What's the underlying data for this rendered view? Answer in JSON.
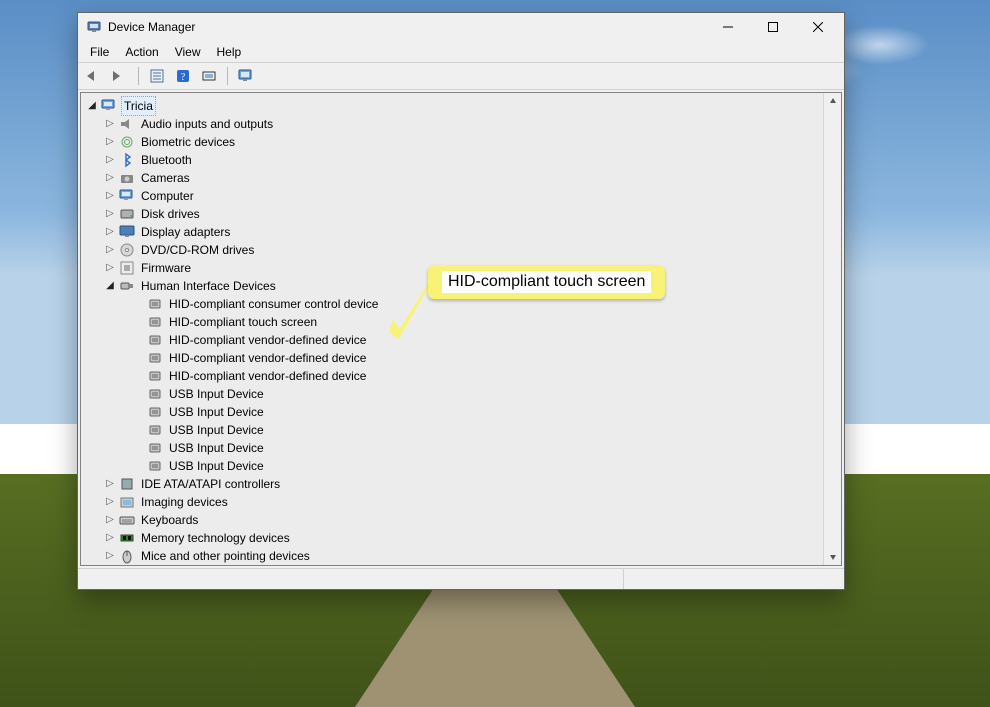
{
  "window": {
    "title": "Device Manager"
  },
  "menu": {
    "file": "File",
    "action": "Action",
    "view": "View",
    "help": "Help"
  },
  "tree": {
    "root": "Tricia",
    "categories": [
      {
        "label": "Audio inputs and outputs",
        "expanded": false
      },
      {
        "label": "Biometric devices",
        "expanded": false
      },
      {
        "label": "Bluetooth",
        "expanded": false
      },
      {
        "label": "Cameras",
        "expanded": false
      },
      {
        "label": "Computer",
        "expanded": false
      },
      {
        "label": "Disk drives",
        "expanded": false
      },
      {
        "label": "Display adapters",
        "expanded": false
      },
      {
        "label": "DVD/CD-ROM drives",
        "expanded": false
      },
      {
        "label": "Firmware",
        "expanded": false
      },
      {
        "label": "Human Interface Devices",
        "expanded": true,
        "children": [
          "HID-compliant consumer control device",
          "HID-compliant touch screen",
          "HID-compliant vendor-defined device",
          "HID-compliant vendor-defined device",
          "HID-compliant vendor-defined device",
          "USB Input Device",
          "USB Input Device",
          "USB Input Device",
          "USB Input Device",
          "USB Input Device"
        ]
      },
      {
        "label": "IDE ATA/ATAPI controllers",
        "expanded": false
      },
      {
        "label": "Imaging devices",
        "expanded": false
      },
      {
        "label": "Keyboards",
        "expanded": false
      },
      {
        "label": "Memory technology devices",
        "expanded": false
      },
      {
        "label": "Mice and other pointing devices",
        "expanded": false
      }
    ]
  },
  "callout": {
    "text": "HID-compliant touch screen"
  }
}
